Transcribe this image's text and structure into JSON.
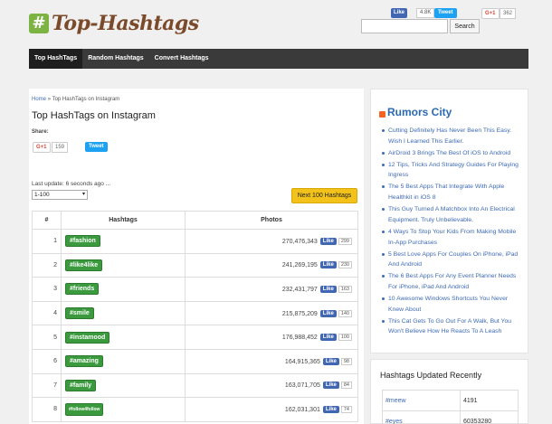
{
  "header": {
    "logo_mark": "#",
    "logo_text": "Top-Hashtags",
    "fb_like_label": "Like",
    "fb_like_count": "4.8K",
    "tweet_label": "Tweet",
    "gplus_label": "G+1",
    "gplus_count": "362",
    "search_placeholder": "",
    "search_button": "Search"
  },
  "nav": [
    "Top HashTags",
    "Random Hashtags",
    "Convert Hashtags"
  ],
  "main": {
    "breadcrumb_home": "Home",
    "breadcrumb_sep": "»",
    "breadcrumb_current": "Top HashTags on Instagram",
    "title": "Top HashTags on Instagram",
    "share_label": "Share:",
    "gplus_label": "G+1",
    "gplus_count": "159",
    "tweet_label": "Tweet",
    "last_update": "Last update: 6 seconds ago ...",
    "range_value": "1-100",
    "next_button": "Next 100 Hashtags",
    "table_headers": [
      "#",
      "Hashtags",
      "Photos"
    ],
    "like_label": "Like",
    "rows": [
      {
        "num": "1",
        "tag": "#fashion",
        "photos": "270,476,343",
        "likes": "299"
      },
      {
        "num": "2",
        "tag": "#like4like",
        "photos": "241,269,195",
        "likes": "230"
      },
      {
        "num": "3",
        "tag": "#friends",
        "photos": "232,431,797",
        "likes": "163"
      },
      {
        "num": "4",
        "tag": "#smile",
        "photos": "215,875,209",
        "likes": "140"
      },
      {
        "num": "5",
        "tag": "#instamood",
        "photos": "176,988,452",
        "likes": "100"
      },
      {
        "num": "6",
        "tag": "#amazing",
        "photos": "164,915,365",
        "likes": "98"
      },
      {
        "num": "7",
        "tag": "#family",
        "photos": "163,071,705",
        "likes": "84"
      },
      {
        "num": "8",
        "tag": "#follow4follow",
        "photos": "162,031,301",
        "likes": "74"
      }
    ]
  },
  "sidebar": {
    "title": "Rumors City",
    "items": [
      "Cutting Definitely Has Never Been This Easy. Wish I Learned This Earlier.",
      "AirDroid 3 Brings The Best Of iOS to Android",
      "12 Tips, Tricks And Strategy Guides For Playing Ingress",
      "The 5 Best Apps That Integrate With Apple Healthkit in iOS 8",
      "This Guy Turned A Matchbox Into An Electrical Equipment. Truly Unbelievable.",
      "4 Ways To Stop Your Kids From Making Mobile In-App Purchases",
      "5 Best Love Apps For Couples On iPhone, iPad And Android",
      "The 6 Best Apps For Any Event Planner Needs For iPhone, iPad And Android",
      "10 Awesome Windows Shortcuts You Never Knew About",
      "This Cat Gets To Go Out For A Walk, But You Won't Believe How He Reacts To A Leash"
    ]
  },
  "updated": {
    "title": "Hashtags Updated Recently",
    "rows": [
      {
        "tag": "#meew",
        "count": "4191"
      },
      {
        "tag": "#eyes",
        "count": "60353280"
      }
    ]
  },
  "colors": {
    "nav_bg": "#3a3a3a",
    "tag_green": "#3b9a3e",
    "link_blue": "#3d6ab5",
    "next_yellow": "#f2c21a",
    "logo_brown": "#7a4a2a"
  }
}
